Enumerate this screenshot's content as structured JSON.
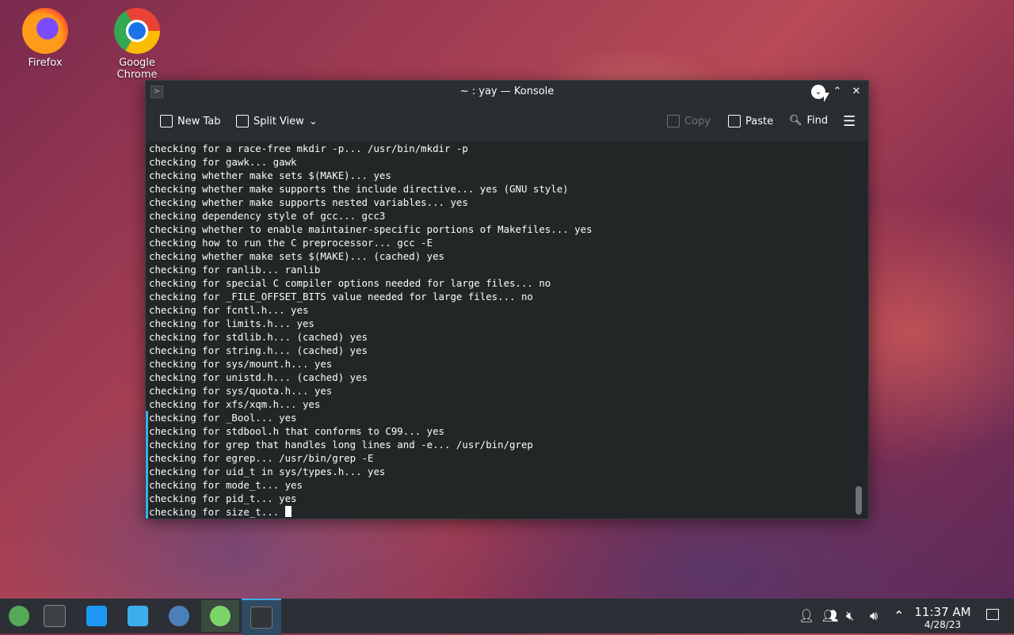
{
  "desktop": {
    "icons": [
      {
        "label": "Firefox"
      },
      {
        "label": "Google Chrome"
      }
    ]
  },
  "window": {
    "title": "~ : yay — Konsole",
    "toolbar": {
      "new_tab": "New Tab",
      "split_view": "Split View",
      "copy": "Copy",
      "paste": "Paste",
      "find": "Find"
    }
  },
  "terminal": {
    "lines": [
      "checking for a race-free mkdir -p... /usr/bin/mkdir -p",
      "checking for gawk... gawk",
      "checking whether make sets $(MAKE)... yes",
      "checking whether make supports the include directive... yes (GNU style)",
      "checking whether make supports nested variables... yes",
      "checking dependency style of gcc... gcc3",
      "checking whether to enable maintainer-specific portions of Makefiles... yes",
      "checking how to run the C preprocessor... gcc -E",
      "checking whether make sets $(MAKE)... (cached) yes",
      "checking for ranlib... ranlib",
      "checking for special C compiler options needed for large files... no",
      "checking for _FILE_OFFSET_BITS value needed for large files... no",
      "checking for fcntl.h... yes",
      "checking for limits.h... yes",
      "checking for stdlib.h... (cached) yes",
      "checking for string.h... (cached) yes",
      "checking for sys/mount.h... yes",
      "checking for unistd.h... (cached) yes",
      "checking for sys/quota.h... yes",
      "checking for xfs/xqm.h... yes",
      "checking for _Bool... yes",
      "checking for stdbool.h that conforms to C99... yes",
      "checking for grep that handles long lines and -e... /usr/bin/grep",
      "checking for egrep... /usr/bin/grep -E",
      "checking for uid_t in sys/types.h... yes",
      "checking for mode_t... yes",
      "checking for pid_t... yes",
      "checking for size_t... "
    ],
    "marked_from_line": 20
  },
  "taskbar": {
    "clock_time": "11:37 AM",
    "clock_date": "4/28/23"
  },
  "colors": {
    "accent": "#3daee9",
    "terminal_bg": "#232627",
    "panel_bg": "#2c3036"
  }
}
